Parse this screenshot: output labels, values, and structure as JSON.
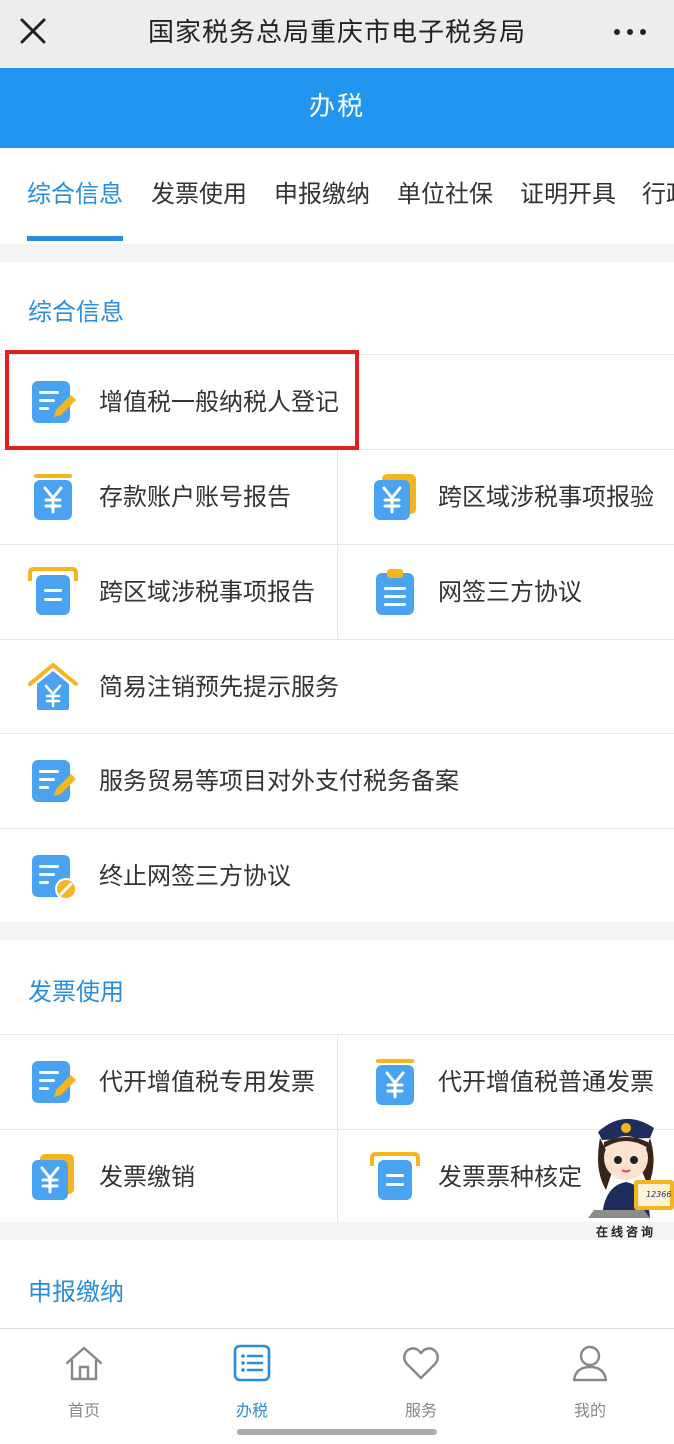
{
  "titlebar": {
    "title": "国家税务总局重庆市电子税务局"
  },
  "header": {
    "title": "办税"
  },
  "tabs": [
    {
      "label": "综合信息"
    },
    {
      "label": "发票使用"
    },
    {
      "label": "申报缴纳"
    },
    {
      "label": "单位社保"
    },
    {
      "label": "证明开具"
    },
    {
      "label": "行政"
    }
  ],
  "sections": {
    "general": {
      "title": "综合信息",
      "items": [
        {
          "label": "增值税一般纳税人登记",
          "icon": "edit-form-icon"
        },
        {
          "label": "存款账户账号报告",
          "icon": "yen-document-icon"
        },
        {
          "label": "跨区域涉税事项报验",
          "icon": "yen-document-icon"
        },
        {
          "label": "跨区域涉税事项报告",
          "icon": "report-document-icon"
        },
        {
          "label": "网签三方协议",
          "icon": "clipboard-icon"
        },
        {
          "label": "简易注销预先提示服务",
          "icon": "yen-house-icon"
        },
        {
          "label": "服务贸易等项目对外支付税务备案",
          "icon": "edit-form-icon"
        },
        {
          "label": "终止网签三方协议",
          "icon": "cancel-form-icon"
        }
      ]
    },
    "invoice": {
      "title": "发票使用",
      "items": [
        {
          "label": "代开增值税专用发票",
          "icon": "edit-form-icon"
        },
        {
          "label": "代开增值税普通发票",
          "icon": "yen-document-icon"
        },
        {
          "label": "发票缴销",
          "icon": "yen-document-icon"
        },
        {
          "label": "发票票种核定",
          "icon": "report-document-icon"
        }
      ]
    },
    "declaration": {
      "title": "申报缴纳"
    }
  },
  "mascot": {
    "caption": "在线咨询",
    "hotline": "12366"
  },
  "bottom_nav": [
    {
      "label": "首页",
      "icon": "home-icon"
    },
    {
      "label": "办税",
      "icon": "list-icon"
    },
    {
      "label": "服务",
      "icon": "heart-icon"
    },
    {
      "label": "我的",
      "icon": "user-icon"
    }
  ],
  "colors": {
    "brand": "#2196f0",
    "accent": "#2a8ddb",
    "icon_blue": "#4aa3f0",
    "icon_orange": "#f6b41e",
    "highlight": "#e02020"
  }
}
